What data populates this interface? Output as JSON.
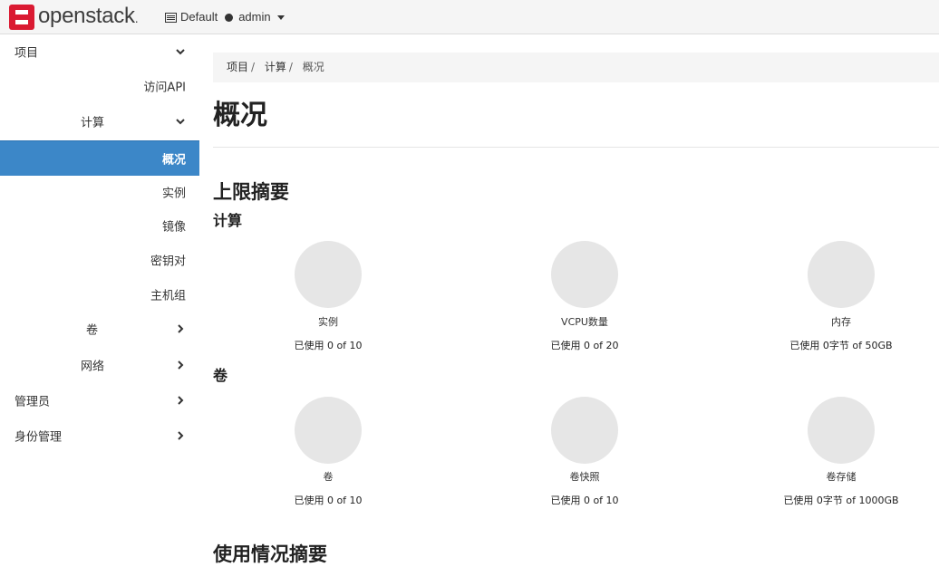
{
  "navbar": {
    "brand": "openstack",
    "brand_suffix": ".",
    "domain": "Default",
    "user": "admin"
  },
  "colors": {
    "brand_red": "#da1a32",
    "active_blue": "#3c87c8",
    "pie_gray": "#e6e6e6"
  },
  "sidebar": {
    "project": "项目",
    "api_access": "访问API",
    "compute": "计算",
    "overview": "概况",
    "instances": "实例",
    "images": "镜像",
    "keypairs": "密钥对",
    "server_groups": "主机组",
    "volumes": "卷",
    "network": "网络",
    "admin": "管理员",
    "identity": "身份管理"
  },
  "breadcrumb": [
    "项目",
    "计算",
    "概况"
  ],
  "breadcrumb_sep": "/",
  "page_title": "概况",
  "limits": {
    "heading": "上限摘要",
    "compute_heading": "计算",
    "volume_heading": "卷",
    "compute": [
      {
        "label": "实例",
        "usage": "已使用 0 of 10"
      },
      {
        "label": "VCPU数量",
        "usage": "已使用 0 of 20"
      },
      {
        "label": "内存",
        "usage": "已使用 0字节 of 50GB"
      }
    ],
    "volume": [
      {
        "label": "卷",
        "usage": "已使用 0 of 10"
      },
      {
        "label": "卷快照",
        "usage": "已使用 0 of 10"
      },
      {
        "label": "卷存储",
        "usage": "已使用 0字节 of 1000GB"
      }
    ]
  },
  "usage_heading": "使用情况摘要"
}
